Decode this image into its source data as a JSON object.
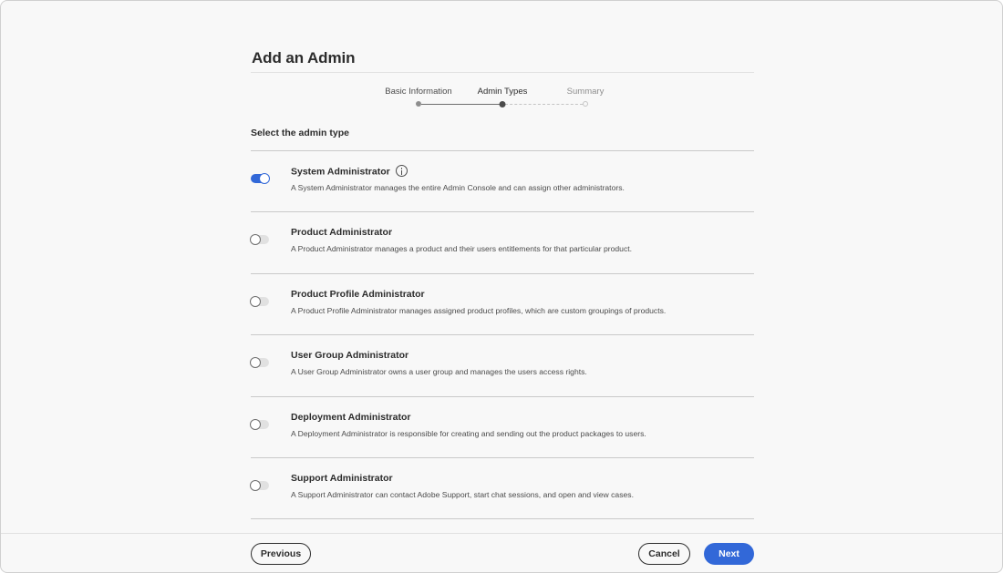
{
  "dialog": {
    "title": "Add an Admin"
  },
  "stepper": {
    "steps": [
      {
        "label": "Basic Information",
        "state": "done"
      },
      {
        "label": "Admin Types",
        "state": "current"
      },
      {
        "label": "Summary",
        "state": "future"
      }
    ]
  },
  "section": {
    "heading": "Select the admin type"
  },
  "admin_types": [
    {
      "name": "System Administrator",
      "enabled": true,
      "has_info_icon": true,
      "description": "A System Administrator manages the entire Admin Console and can assign other administrators."
    },
    {
      "name": "Product Administrator",
      "enabled": false,
      "description": "A Product Administrator manages a product and their users entitlements for that particular product."
    },
    {
      "name": "Product Profile Administrator",
      "enabled": false,
      "description": "A Product Profile Administrator manages assigned product profiles, which are custom groupings of products."
    },
    {
      "name": "User Group Administrator",
      "enabled": false,
      "description": "A User Group Administrator owns a user group and manages the users access rights."
    },
    {
      "name": "Deployment Administrator",
      "enabled": false,
      "description": "A Deployment Administrator is responsible for creating and sending out the product packages to users."
    },
    {
      "name": "Support Administrator",
      "enabled": false,
      "description": "A Support Administrator can contact Adobe Support, start chat sessions, and open and view cases."
    }
  ],
  "footer": {
    "previous_label": "Previous",
    "cancel_label": "Cancel",
    "next_label": "Next"
  },
  "colors": {
    "accent": "#3268d8",
    "background": "#f8f8f8",
    "divider": "#cacaca"
  },
  "icons": {
    "info": "info-icon"
  }
}
